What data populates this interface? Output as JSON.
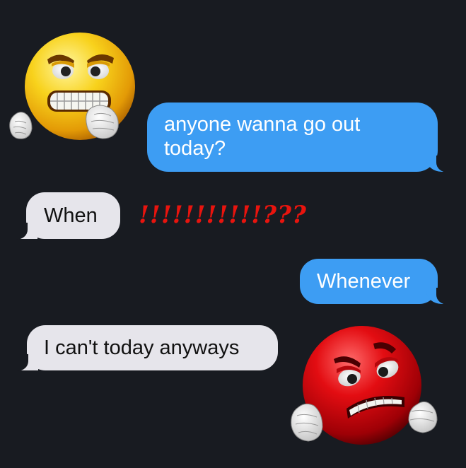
{
  "messages": [
    {
      "side": "outgoing",
      "text": "anyone wanna go out\ntoday?"
    },
    {
      "side": "incoming",
      "text": "When"
    },
    {
      "side": "outgoing",
      "text": "Whenever"
    },
    {
      "side": "incoming",
      "text": "I can't today anyways"
    }
  ],
  "reaction": {
    "text": "!!!!!!!!!!!???",
    "color": "#e8140e"
  },
  "emojis": {
    "yellow": "angry-yellow-face-fist-icon",
    "red": "angry-red-face-fists-icon"
  },
  "colors": {
    "background": "#181b21",
    "outgoing_bubble": "#3d9df3",
    "incoming_bubble": "#e6e5eb"
  }
}
